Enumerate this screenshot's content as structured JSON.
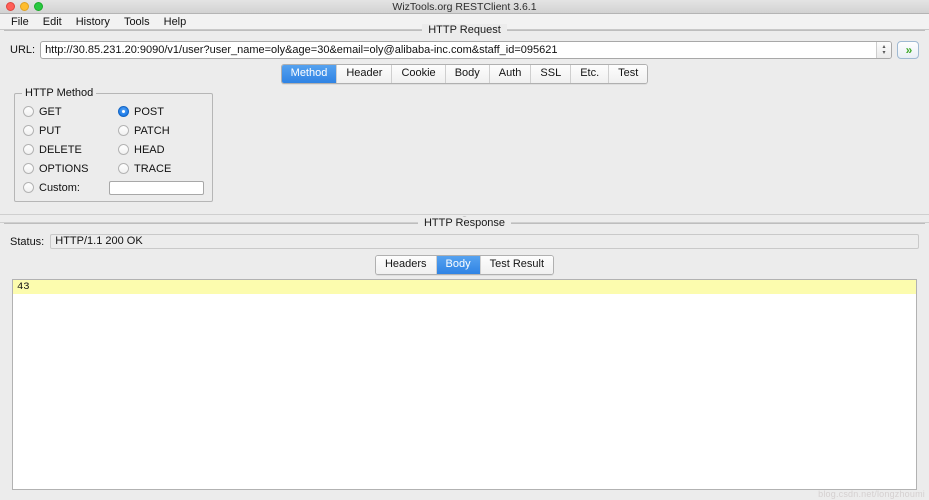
{
  "window": {
    "title": "WizTools.org RESTClient 3.6.1",
    "controls": [
      "close-button",
      "minimize-button",
      "zoom-button"
    ]
  },
  "menubar": {
    "items": [
      {
        "label": "File"
      },
      {
        "label": "Edit"
      },
      {
        "label": "History"
      },
      {
        "label": "Tools"
      },
      {
        "label": "Help"
      }
    ]
  },
  "request": {
    "panel_title": "HTTP Request",
    "url_label": "URL:",
    "url_value": "http://30.85.231.20:9090/v1/user?user_name=oly&age=30&email=oly@alibaba-inc.com&staff_id=095621",
    "url_placeholder": "",
    "spinner_up": "▴",
    "spinner_down": "▾",
    "go_label": "»",
    "tabs": [
      {
        "label": "Method",
        "active": true
      },
      {
        "label": "Header",
        "active": false
      },
      {
        "label": "Cookie",
        "active": false
      },
      {
        "label": "Body",
        "active": false
      },
      {
        "label": "Auth",
        "active": false
      },
      {
        "label": "SSL",
        "active": false
      },
      {
        "label": "Etc.",
        "active": false
      },
      {
        "label": "Test",
        "active": false
      }
    ],
    "method_group": {
      "legend": "HTTP Method",
      "options": [
        {
          "label": "GET",
          "selected": false
        },
        {
          "label": "POST",
          "selected": true
        },
        {
          "label": "PUT",
          "selected": false
        },
        {
          "label": "PATCH",
          "selected": false
        },
        {
          "label": "DELETE",
          "selected": false
        },
        {
          "label": "HEAD",
          "selected": false
        },
        {
          "label": "OPTIONS",
          "selected": false
        },
        {
          "label": "TRACE",
          "selected": false
        }
      ],
      "custom": {
        "label": "Custom:",
        "selected": false,
        "value": "",
        "placeholder": ""
      }
    }
  },
  "response": {
    "panel_title": "HTTP Response",
    "status_label": "Status:",
    "status_value": "HTTP/1.1 200 OK",
    "tabs": [
      {
        "label": "Headers",
        "active": false
      },
      {
        "label": "Body",
        "active": true
      },
      {
        "label": "Test Result",
        "active": false
      }
    ],
    "body_text": "43"
  },
  "watermark": "blog.csdn.net/longzhoumi"
}
